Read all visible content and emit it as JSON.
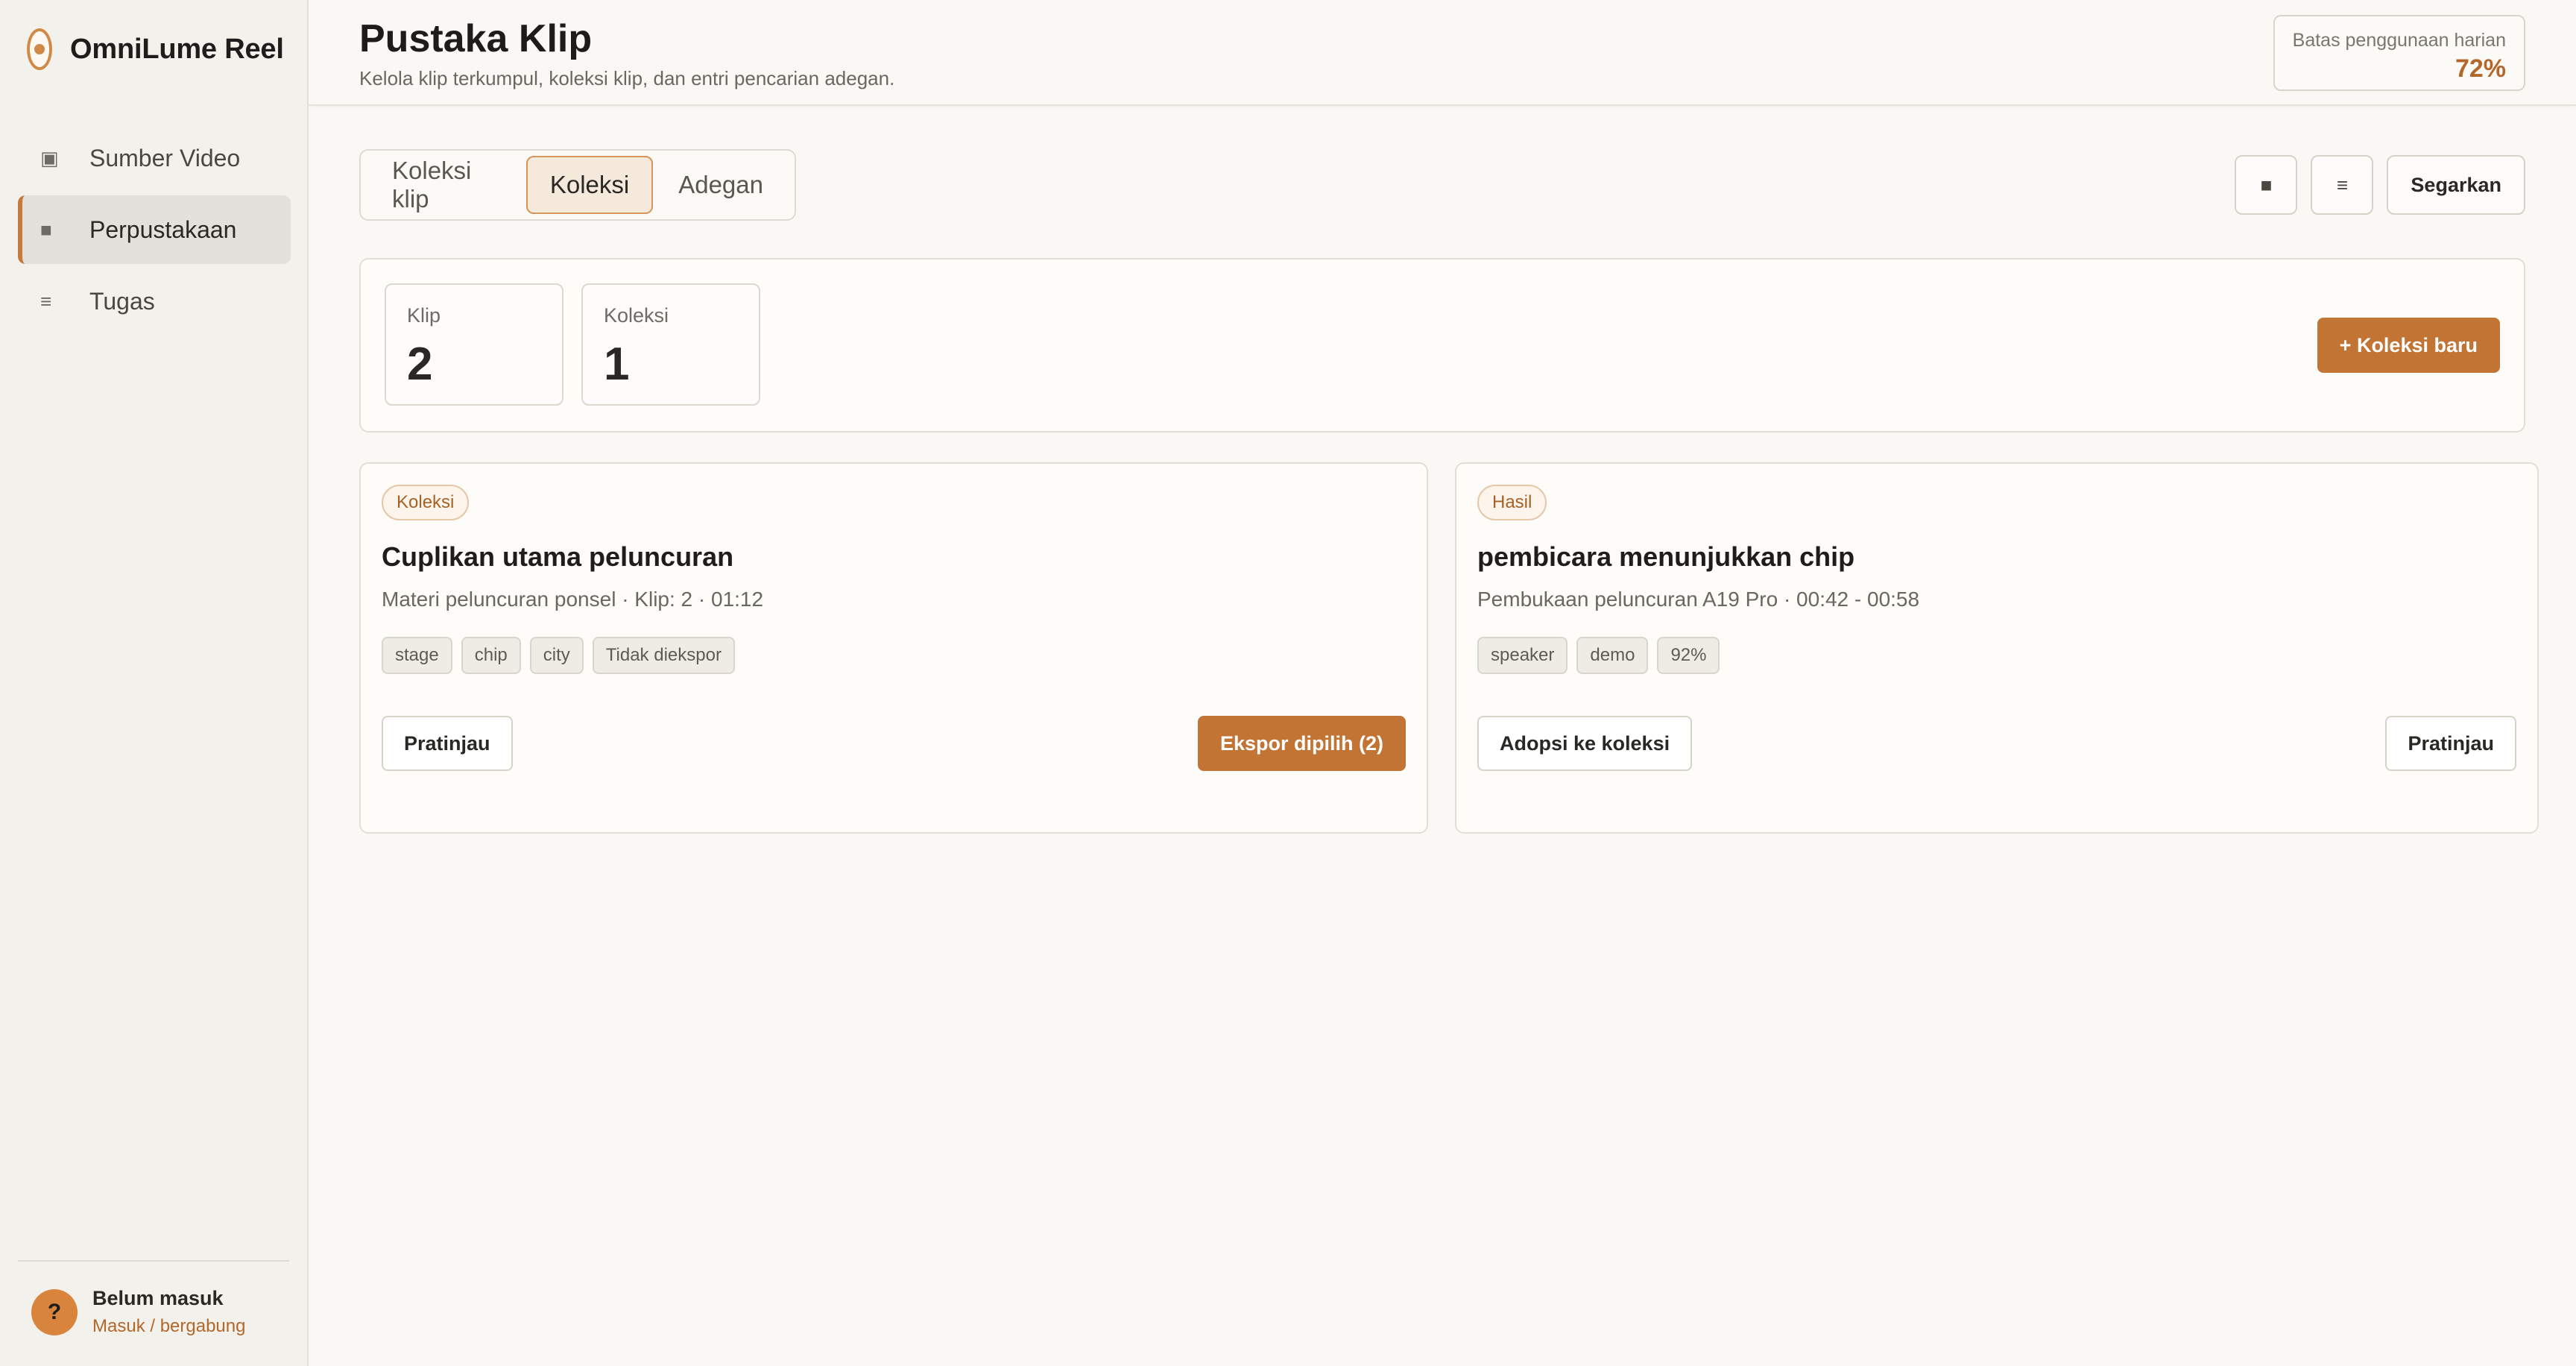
{
  "app": {
    "name": "OmniLume Reel"
  },
  "sidebar": {
    "items": [
      {
        "label": "Sumber Video",
        "icon": "video-source-icon",
        "active": false
      },
      {
        "label": "Perpustakaan",
        "icon": "library-icon",
        "active": true
      },
      {
        "label": "Tugas",
        "icon": "tasks-icon",
        "active": false
      }
    ],
    "user": {
      "avatar": "?",
      "name": "Belum masuk",
      "link": "Masuk / bergabung"
    }
  },
  "header": {
    "title": "Pustaka Klip",
    "subtitle": "Kelola klip terkumpul, koleksi klip, dan entri pencarian adegan.",
    "usage_label": "Batas penggunaan harian",
    "usage_value": "72%"
  },
  "tabs": [
    {
      "label": "Koleksi klip",
      "active": false
    },
    {
      "label": "Koleksi",
      "active": true
    },
    {
      "label": "Adegan",
      "active": false
    }
  ],
  "toolbar": {
    "grid_view_icon": "grid-view-icon",
    "list_view_icon": "list-view-icon",
    "refresh_label": "Segarkan"
  },
  "stats": [
    {
      "label": "Klip",
      "value": "2"
    },
    {
      "label": "Koleksi",
      "value": "1"
    }
  ],
  "new_collection_label": "+ Koleksi baru",
  "cards": [
    {
      "badge": "Koleksi",
      "title": "Cuplikan utama peluncuran",
      "meta": "Materi peluncuran ponsel · Klip: 2 · 01:12",
      "tags": [
        "stage",
        "chip",
        "city",
        "Tidak diekspor"
      ],
      "left_button": "Pratinjau",
      "right_button": "Ekspor dipilih (2)"
    },
    {
      "badge": "Hasil",
      "title": "pembicara menunjukkan chip",
      "meta": "Pembukaan peluncuran A19 Pro · 00:42 - 00:58",
      "tags": [
        "speaker",
        "demo",
        "92%"
      ],
      "left_button": "Adopsi ke koleksi",
      "right_button": "Pratinjau"
    }
  ],
  "colors": {
    "accent": "#c27434",
    "accent_text": "#b3672a",
    "sidebar_bg": "#f3f1ec",
    "page_bg": "#f9f8f5"
  }
}
